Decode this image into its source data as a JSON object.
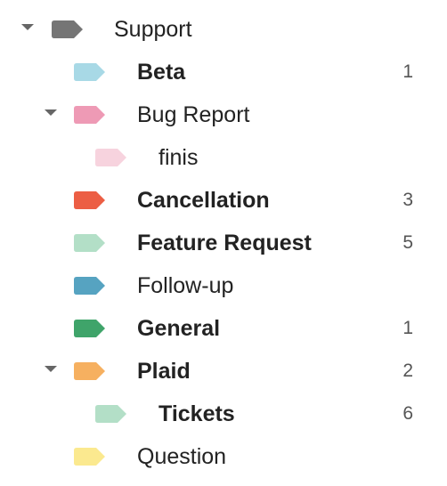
{
  "labels": [
    {
      "name": "Support",
      "color": "#757575",
      "count": "",
      "bold": false,
      "expanded": true,
      "depth": 0
    },
    {
      "name": "Beta",
      "color": "#a8d9e6",
      "count": "1",
      "bold": true,
      "expanded": null,
      "depth": 1
    },
    {
      "name": "Bug Report",
      "color": "#ee9ab5",
      "count": "",
      "bold": false,
      "expanded": true,
      "depth": 1
    },
    {
      "name": "finis",
      "color": "#f7d3de",
      "count": "",
      "bold": false,
      "expanded": null,
      "depth": 2
    },
    {
      "name": "Cancellation",
      "color": "#ec5e44",
      "count": "3",
      "bold": true,
      "expanded": null,
      "depth": 1
    },
    {
      "name": "Feature Request",
      "color": "#b3dfc7",
      "count": "5",
      "bold": true,
      "expanded": null,
      "depth": 1
    },
    {
      "name": "Follow-up",
      "color": "#56a3c1",
      "count": "",
      "bold": false,
      "expanded": null,
      "depth": 1
    },
    {
      "name": "General",
      "color": "#3fa46a",
      "count": "1",
      "bold": true,
      "expanded": null,
      "depth": 1
    },
    {
      "name": "Plaid",
      "color": "#f6b060",
      "count": "2",
      "bold": true,
      "expanded": true,
      "depth": 1
    },
    {
      "name": "Tickets",
      "color": "#b3dfc7",
      "count": "6",
      "bold": true,
      "expanded": null,
      "depth": 2
    },
    {
      "name": "Question",
      "color": "#fbe98f",
      "count": "",
      "bold": false,
      "expanded": null,
      "depth": 1
    }
  ],
  "icons": {
    "expander": "caret-down-icon",
    "label": "label-tag-icon"
  }
}
